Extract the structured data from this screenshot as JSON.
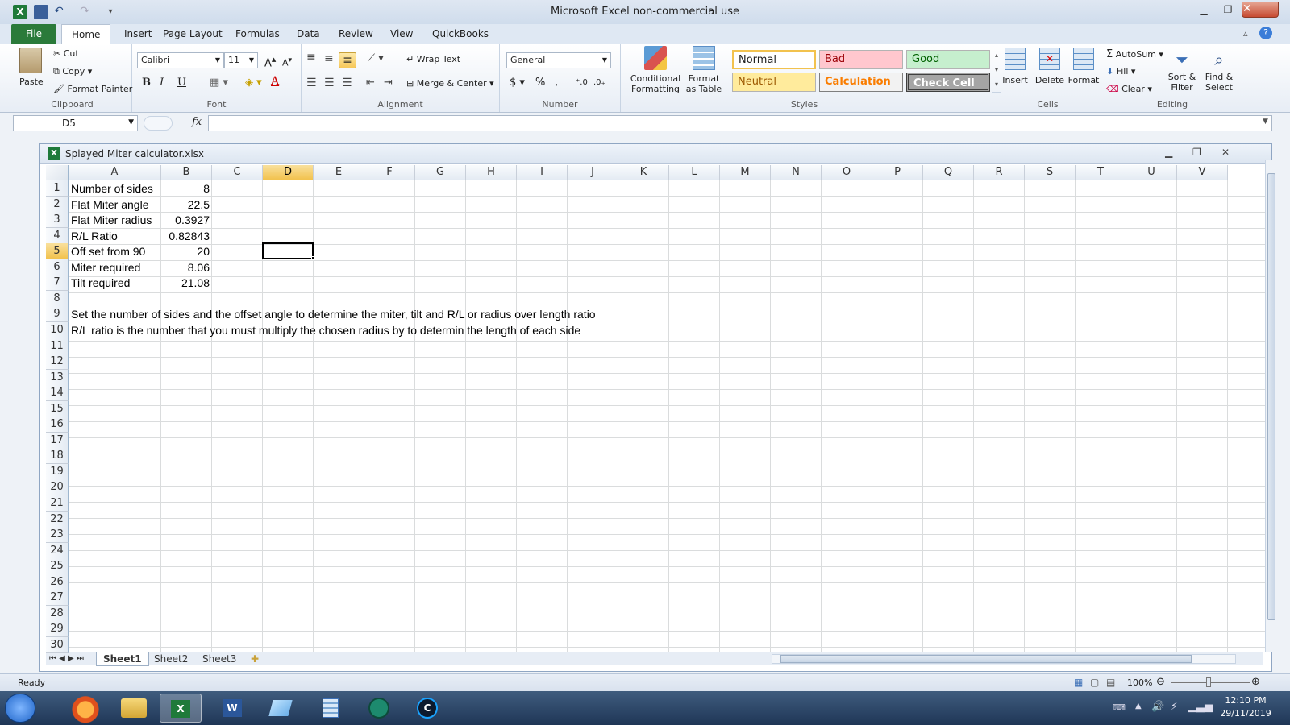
{
  "window": {
    "title": "Microsoft Excel non-commercial use"
  },
  "ribbon_tabs": [
    "File",
    "Home",
    "Insert",
    "Page Layout",
    "Formulas",
    "Data",
    "Review",
    "View",
    "QuickBooks"
  ],
  "clipboard": {
    "paste": "Paste",
    "cut": "Cut",
    "copy": "Copy",
    "format_painter": "Format Painter",
    "label": "Clipboard"
  },
  "font": {
    "name": "Calibri",
    "size": "11",
    "label": "Font",
    "bold": "B",
    "italic": "I",
    "underline": "U"
  },
  "alignment": {
    "wrap": "Wrap Text",
    "merge": "Merge & Center",
    "label": "Alignment"
  },
  "number": {
    "format": "General",
    "currency": "$",
    "percent": "%",
    "comma": ",",
    "label": "Number"
  },
  "styles": {
    "cond_format": "Conditional Formatting",
    "format_table": "Format as Table",
    "normal": "Normal",
    "bad": "Bad",
    "good": "Good",
    "neutral": "Neutral",
    "calculation": "Calculation",
    "check_cell": "Check Cell",
    "label": "Styles"
  },
  "cells_group": {
    "insert": "Insert",
    "delete": "Delete",
    "format": "Format",
    "label": "Cells"
  },
  "editing": {
    "autosum": "AutoSum",
    "fill": "Fill",
    "clear": "Clear",
    "sort": "Sort & Filter",
    "find": "Find & Select",
    "label": "Editing"
  },
  "formula_bar": {
    "name_box": "D5",
    "fx": "fx",
    "value": ""
  },
  "workbook": {
    "title": "Splayed Miter calculator.xlsx"
  },
  "columns": [
    "A",
    "B",
    "C",
    "D",
    "E",
    "F",
    "G",
    "H",
    "I",
    "J",
    "K",
    "L",
    "M",
    "N",
    "O",
    "P",
    "Q",
    "R",
    "S",
    "T",
    "U",
    "V"
  ],
  "rows": [
    "1",
    "2",
    "3",
    "4",
    "5",
    "6",
    "7",
    "8",
    "9",
    "10",
    "11",
    "12",
    "13",
    "14",
    "15",
    "16",
    "17",
    "18",
    "19",
    "20",
    "21",
    "22",
    "23",
    "24",
    "25",
    "26",
    "27",
    "28",
    "29",
    "30"
  ],
  "cells": {
    "A1": "Number of sides",
    "B1": "8",
    "A2": "Flat Miter angle",
    "B2": "22.5",
    "A3": "Flat Miter radius",
    "B3": "0.3927",
    "A4": "R/L Ratio",
    "B4": "0.82843",
    "A5": "Off set from 90",
    "B5": "20",
    "A6": "Miter required",
    "B6": "8.06",
    "A7": "Tilt required",
    "B7": "21.08",
    "A9": "Set the number of sides and the offset angle to determine the miter, tilt and R/L or radius over length ratio",
    "A10": "R/L ratio is the number that you must multiply the chosen radius by to determin the length of each side"
  },
  "sheets": [
    "Sheet1",
    "Sheet2",
    "Sheet3"
  ],
  "status": {
    "ready": "Ready",
    "zoom": "100%"
  },
  "clock": {
    "time": "12:10 PM",
    "date": "29/11/2019"
  }
}
